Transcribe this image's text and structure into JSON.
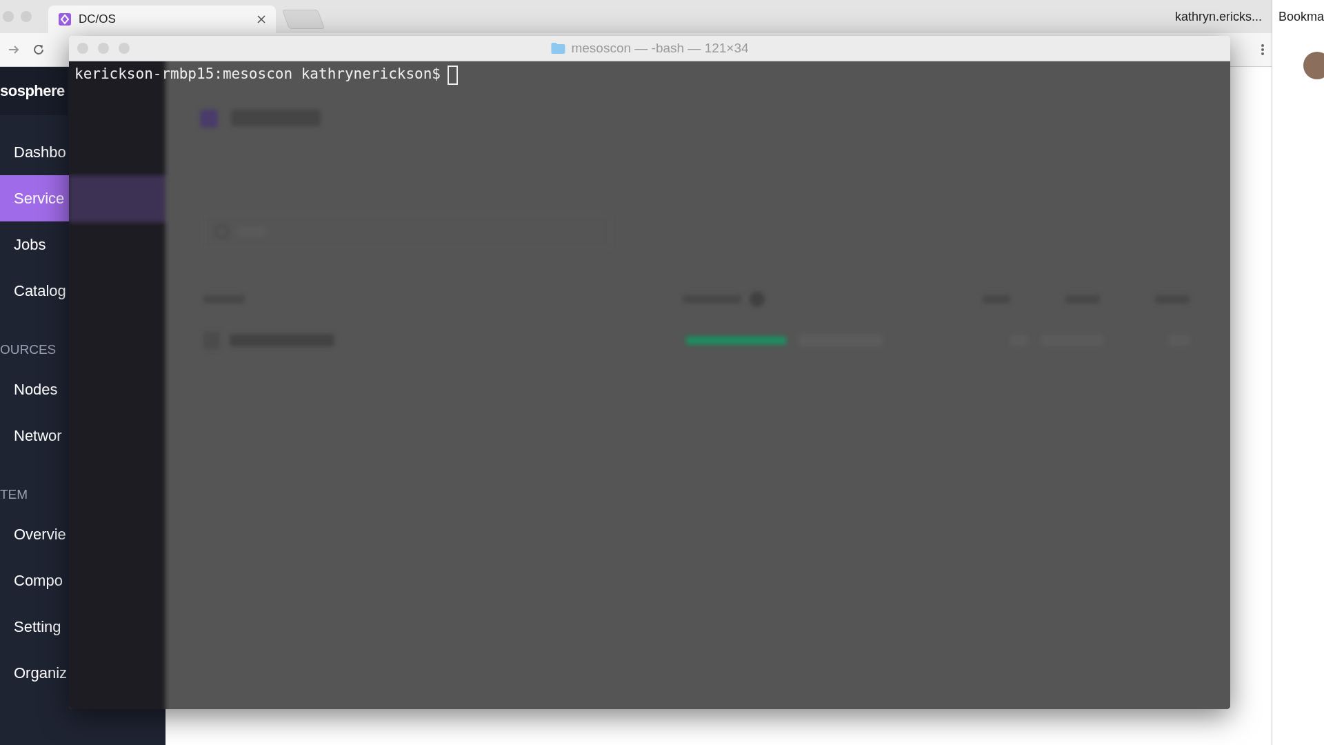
{
  "browser": {
    "tabs": [
      {
        "title": "DC/OS",
        "selected": true
      }
    ],
    "profile": "kathryn.ericks..."
  },
  "sidebar": {
    "brand": "sosphere",
    "sections": [
      {
        "items": [
          {
            "label": "Dashbo",
            "selected": false
          },
          {
            "label": "Service",
            "selected": true
          },
          {
            "label": "Jobs",
            "selected": false
          },
          {
            "label": "Catalog",
            "selected": false
          }
        ]
      },
      {
        "heading": "OURCES",
        "items": [
          {
            "label": "Nodes",
            "selected": false
          },
          {
            "label": "Networ",
            "selected": false
          }
        ]
      },
      {
        "heading": "TEM",
        "items": [
          {
            "label": "Overvie",
            "selected": false
          },
          {
            "label": "Compo",
            "selected": false
          },
          {
            "label": "Setting",
            "selected": false
          },
          {
            "label": "Organiz",
            "selected": false
          }
        ]
      }
    ]
  },
  "terminal": {
    "title": "mesoscon — -bash — 121×34",
    "prompt": "kerickson-rmbp15:mesoscon kathrynerickson$"
  },
  "side_window": {
    "title": "Bookma"
  }
}
